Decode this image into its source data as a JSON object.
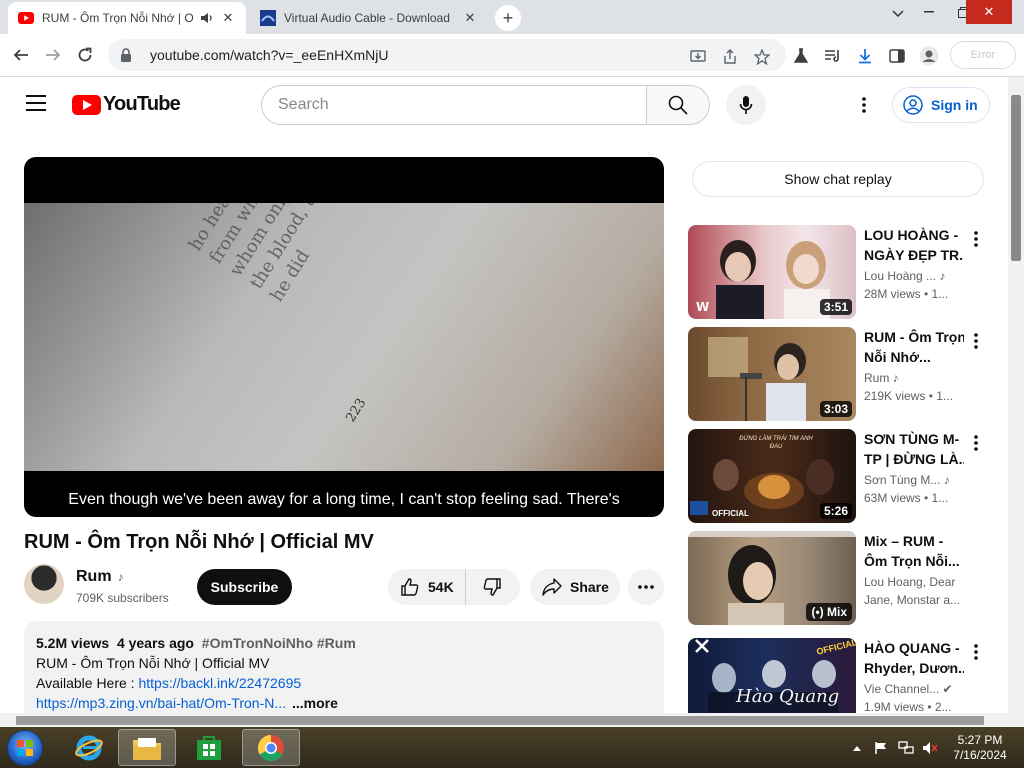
{
  "browser": {
    "tabs": [
      {
        "title": "RUM - Ôm Trọn Nỗi Nhớ | O",
        "active": true,
        "favicon": "youtube-icon",
        "audio": true
      },
      {
        "title": "Virtual Audio Cable - Download",
        "active": false,
        "favicon": "vac-icon"
      }
    ],
    "url": "youtube.com/watch?v=_eeEnHXmNjU",
    "profile_label": "Error",
    "window_controls": [
      "chevron-down-icon",
      "minimize-icon",
      "restore-icon",
      "close-icon"
    ]
  },
  "masthead": {
    "logo_text": "YouTube",
    "search_placeholder": "Search",
    "signin_label": "Sign in"
  },
  "video": {
    "caption": "Even though we've been away for a long time, I can't stop feeling sad.  There's",
    "frame_text": "ho hear\nfrom which\nwhom only as\nthe blood, they\nhe did",
    "page_number": "223",
    "title": "RUM - Ôm Trọn Nỗi Nhớ | Official MV",
    "channel": "Rum",
    "subscribers": "709K subscribers",
    "subscribe_label": "Subscribe",
    "likes": "54K",
    "share_label": "Share"
  },
  "description": {
    "views": "5.2M views",
    "age": "4 years ago",
    "tags": "#OmTronNoiNho #Rum",
    "line1": "RUM - Ôm Trọn Nỗi Nhớ |  Official MV",
    "line2_prefix": "Available Here : ",
    "link1": "https://backl.ink/22472695",
    "link2": "https://mp3.zing.vn/bai-hat/Om-Tron-N...",
    "more_label": "...more"
  },
  "sidebar": {
    "chat_replay_label": "Show chat replay",
    "recommendations": [
      {
        "title1": "LOU HOÀNG -",
        "title2": "NGÀY ĐẸP TR...",
        "channel": "Lou Hoàng ...",
        "meta": "28M views  • 1...",
        "duration": "3:51"
      },
      {
        "title1": "RUM - Ôm Trọn",
        "title2": "Nỗi Nhớ...",
        "channel": "Rum",
        "meta": "219K views  • 1...",
        "duration": "3:03"
      },
      {
        "title1": "SƠN TÙNG M-",
        "title2": "TP | ĐỪNG LÀ...",
        "channel": "Sơn Tùng M...",
        "meta": "63M views  • 1...",
        "duration": "5:26",
        "thumb_text": "ĐỪNG LÀM TRÁI TIM ANH ĐAU",
        "thumb_badge": "OFFICIAL"
      },
      {
        "title1": "Mix – RUM -",
        "title2": "Ôm Trọn Nỗi...",
        "channel": "Lou Hoang, Dear",
        "meta": "Jane, Monstar a...",
        "duration": "Mix"
      },
      {
        "title1": "HÀO QUANG -",
        "title2": "Rhyder, Dươn...",
        "channel": "Vie Channel...",
        "meta": "1.9M views  • 2...",
        "duration": "",
        "thumb_text": "Hào Quang",
        "thumb_badge": "OFFICIAL"
      }
    ]
  },
  "taskbar": {
    "time": "5:27 PM",
    "date": "7/16/2024",
    "apps": [
      "windows-start-icon",
      "internet-explorer-icon",
      "file-explorer-icon",
      "store-icon",
      "chrome-icon"
    ]
  },
  "colors": {
    "youtube_red": "#ff0000",
    "link_blue": "#065fd4",
    "close_red": "#c42b1c"
  }
}
